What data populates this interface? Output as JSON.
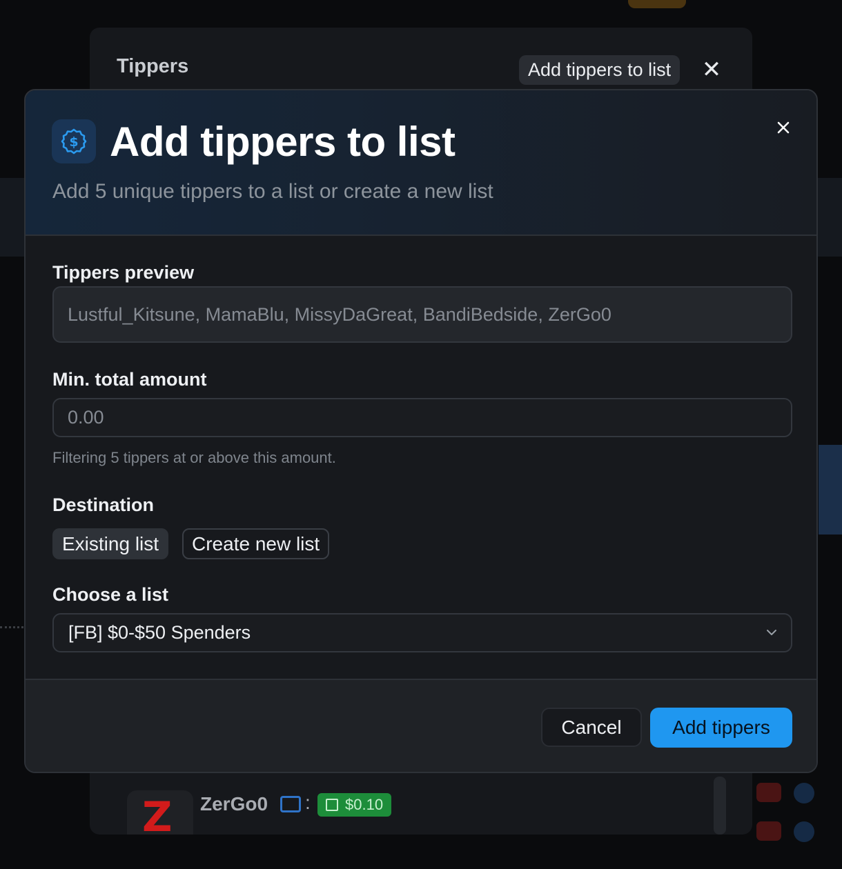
{
  "tippers_dialog": {
    "title": "Tippers",
    "add_button_label": "Add tippers to list",
    "close_icon": "close-icon",
    "row": {
      "avatar_letter": "Z",
      "name": "ZerGo0",
      "separator": ":",
      "amount": "$0.10"
    }
  },
  "modal": {
    "icon": "dollar-circle-icon",
    "title": "Add tippers to list",
    "subtitle": "Add 5 unique tippers to a list or create a new list",
    "close_icon": "close-icon",
    "tippers_preview": {
      "label": "Tippers preview",
      "value": "Lustful_Kitsune, MamaBlu, MissyDaGreat, BandiBedside, ZerGo0"
    },
    "min_amount": {
      "label": "Min. total amount",
      "placeholder": "0.00",
      "helper": "Filtering 5 tippers at or above this amount."
    },
    "destination": {
      "label": "Destination",
      "options": [
        "Existing list",
        "Create new list"
      ],
      "selected": "Existing list"
    },
    "choose_list": {
      "label": "Choose a list",
      "selected": "[FB] $0-$50 Spenders"
    },
    "footer": {
      "cancel_label": "Cancel",
      "submit_label": "Add tippers"
    }
  },
  "colors": {
    "accent": "#1f97f0",
    "modal_bg": "#17191d",
    "amount_badge": "#1d8d3a"
  }
}
